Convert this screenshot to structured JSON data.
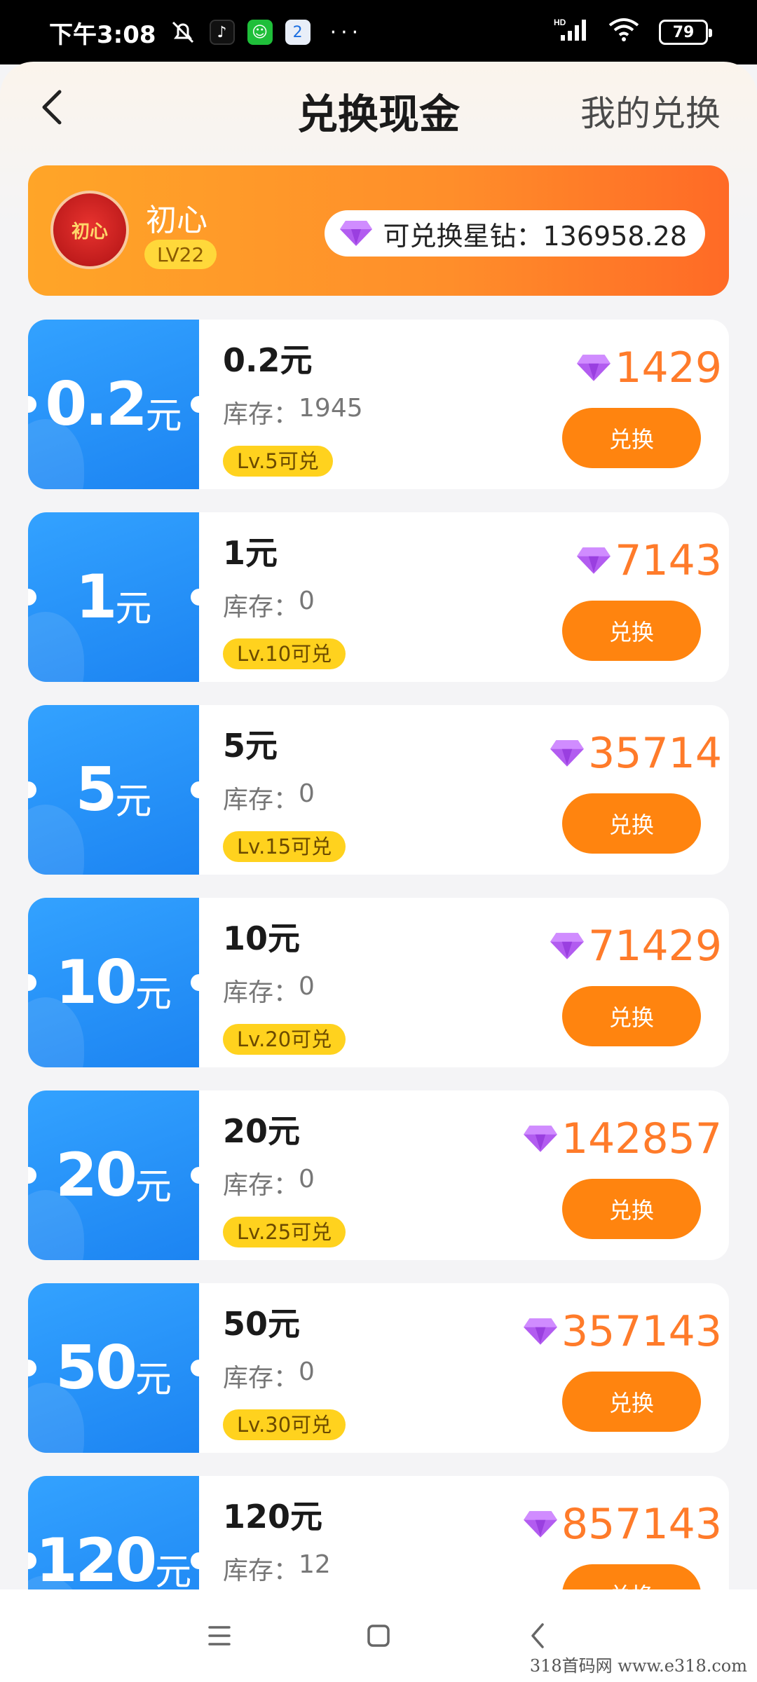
{
  "status_bar": {
    "time": "下午3:08",
    "network": "HD",
    "battery": "79",
    "more": "···"
  },
  "header": {
    "title": "兑换现金",
    "my_exchange": "我的兑换"
  },
  "user": {
    "name": "初心",
    "level": "LV22",
    "avatar_text": "初心",
    "balance_label": "可兑换星钻：136958.28"
  },
  "items": [
    {
      "amount": "0.2",
      "unit": "元",
      "title": "0.2元",
      "stock_label": "库存：",
      "stock": "1945",
      "level_req": "Lv.5可兑",
      "price": "1429",
      "button": "兑换"
    },
    {
      "amount": "1",
      "unit": "元",
      "title": "1元",
      "stock_label": "库存：",
      "stock": "0",
      "level_req": "Lv.10可兑",
      "price": "7143",
      "button": "兑换"
    },
    {
      "amount": "5",
      "unit": "元",
      "title": "5元",
      "stock_label": "库存：",
      "stock": "0",
      "level_req": "Lv.15可兑",
      "price": "35714",
      "button": "兑换"
    },
    {
      "amount": "10",
      "unit": "元",
      "title": "10元",
      "stock_label": "库存：",
      "stock": "0",
      "level_req": "Lv.20可兑",
      "price": "71429",
      "button": "兑换"
    },
    {
      "amount": "20",
      "unit": "元",
      "title": "20元",
      "stock_label": "库存：",
      "stock": "0",
      "level_req": "Lv.25可兑",
      "price": "142857",
      "button": "兑换"
    },
    {
      "amount": "50",
      "unit": "元",
      "title": "50元",
      "stock_label": "库存：",
      "stock": "0",
      "level_req": "Lv.30可兑",
      "price": "357143",
      "button": "兑换"
    },
    {
      "amount": "120",
      "unit": "元",
      "title": "120元",
      "stock_label": "库存：",
      "stock": "12",
      "level_req": "",
      "price": "857143",
      "button": "兑换"
    }
  ],
  "watermark": "318首码网  www.e318.com",
  "colors": {
    "accent": "#ff840f",
    "coupon_blue": "#1c84f2",
    "price_orange": "#ff7b2a",
    "level_yellow": "#ffd21e"
  },
  "icons": [
    "back-arrow-icon",
    "diamond-icon",
    "menu-icon",
    "home-icon",
    "nav-back-icon"
  ]
}
